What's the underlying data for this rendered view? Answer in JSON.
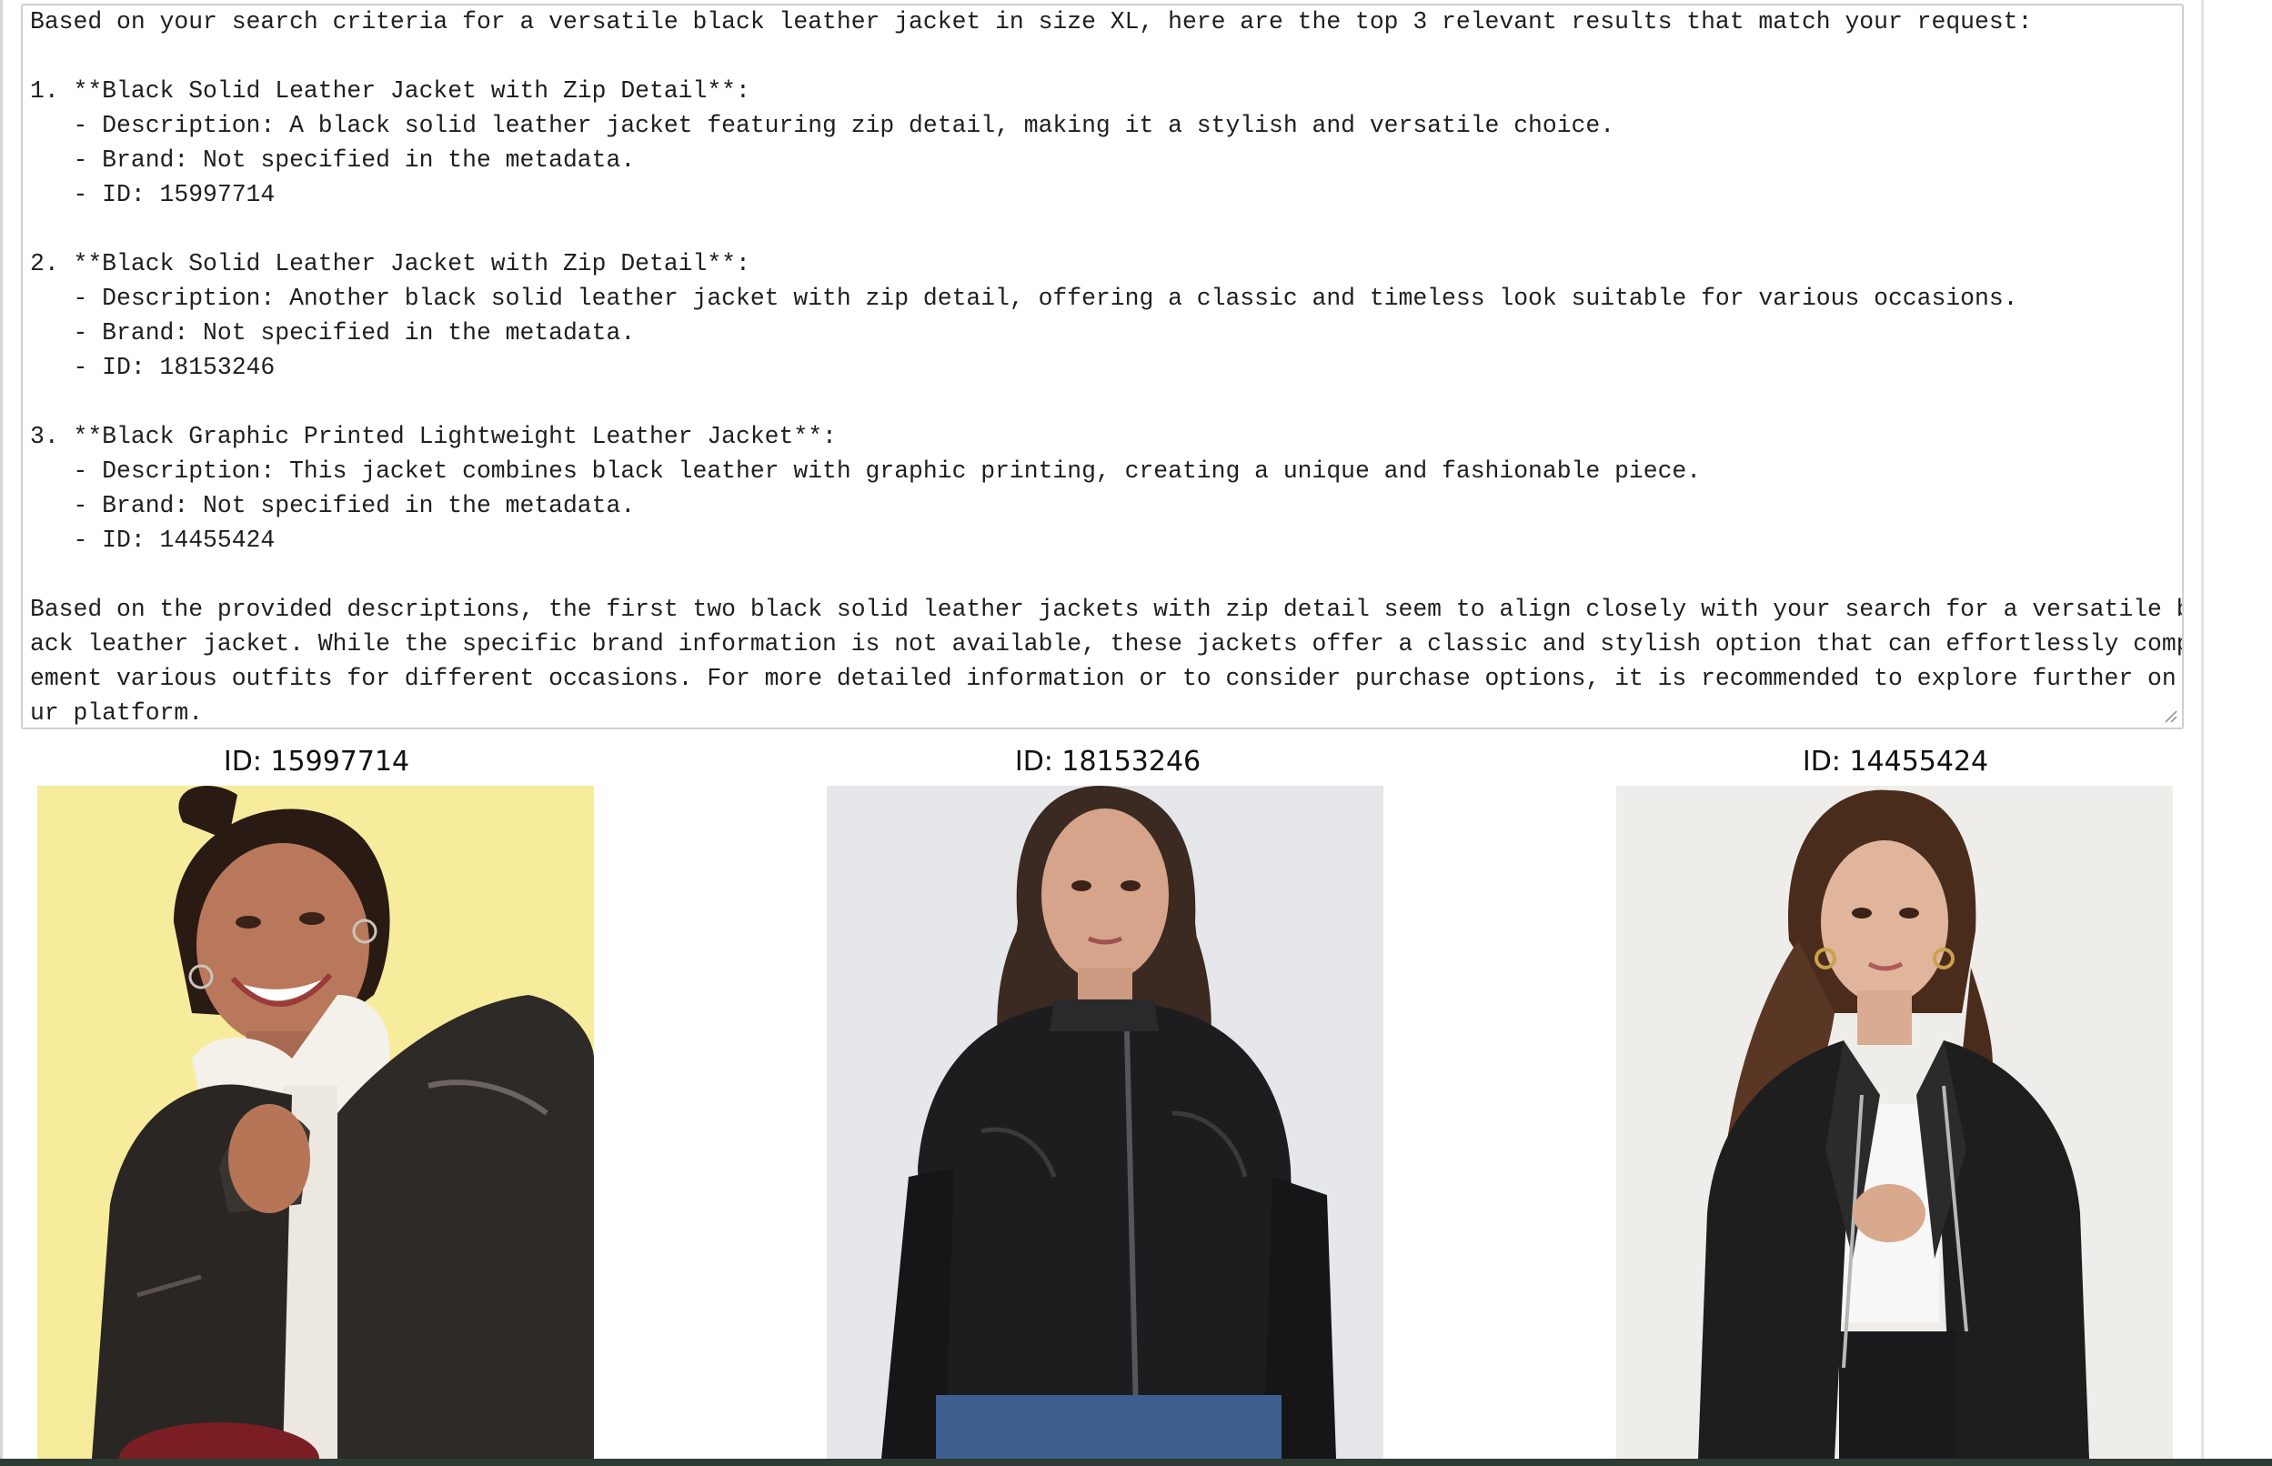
{
  "output": {
    "lines": [
      "Based on your search criteria for a versatile black leather jacket in size XL, here are the top 3 relevant results that match your request:",
      "",
      "1. **Black Solid Leather Jacket with Zip Detail**:",
      "   - Description: A black solid leather jacket featuring zip detail, making it a stylish and versatile choice.",
      "   - Brand: Not specified in the metadata.",
      "   - ID: 15997714",
      "",
      "2. **Black Solid Leather Jacket with Zip Detail**:",
      "   - Description: Another black solid leather jacket with zip detail, offering a classic and timeless look suitable for various occasions.",
      "   - Brand: Not specified in the metadata.",
      "   - ID: 18153246",
      "",
      "3. **Black Graphic Printed Lightweight Leather Jacket**:",
      "   - Description: This jacket combines black leather with graphic printing, creating a unique and fashionable piece.",
      "   - Brand: Not specified in the metadata.",
      "   - ID: 14455424",
      "",
      "Based on the provided descriptions, the first two black solid leather jackets with zip detail seem to align closely with your search for a versatile bl",
      "ack leather jacket. While the specific brand information is not available, these jackets offer a classic and stylish option that can effortlessly compl",
      "ement various outfits for different occasions. For more detailed information or to consider purchase options, it is recommended to explore further on o",
      "ur platform."
    ]
  },
  "results": [
    {
      "caption": "ID: 15997714",
      "background": "#f6ec9c",
      "icon": "woman-in-black-leather-jacket-with-sherpa-collar-image"
    },
    {
      "caption": "ID: 18153246",
      "background": "#e6e7eb",
      "icon": "woman-in-black-zip-leather-jacket-image"
    },
    {
      "caption": "ID: 14455424",
      "background": "#efedea",
      "icon": "woman-in-black-biker-leather-jacket-image"
    }
  ],
  "colors": {
    "text": "#1f1f1f",
    "border": "#cfcfcf",
    "bottom_bar": "#2e3b33"
  }
}
